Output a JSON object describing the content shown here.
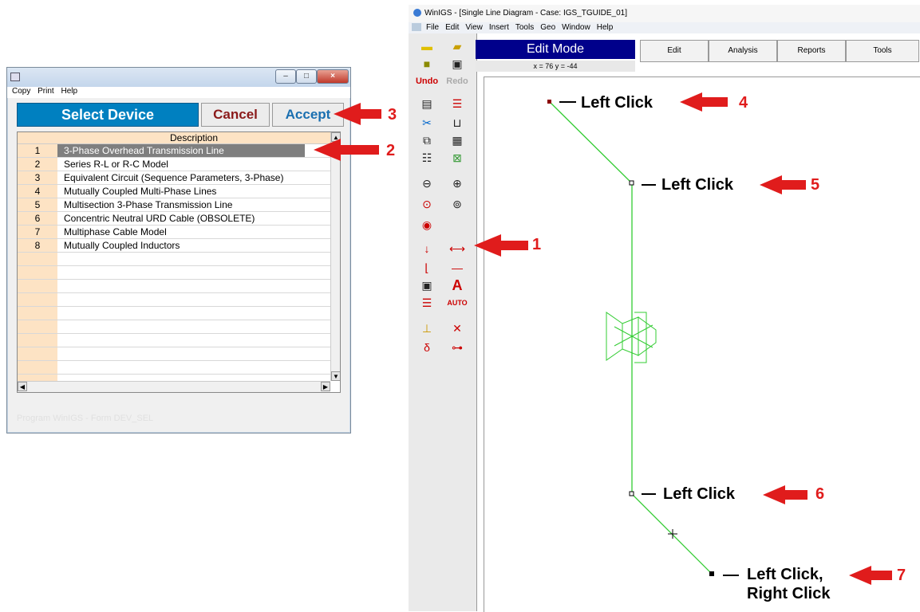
{
  "dialog": {
    "menu": [
      "Copy",
      "Print",
      "Help"
    ],
    "title_button": "Select Device",
    "cancel": "Cancel",
    "accept": "Accept",
    "column_header": "Description",
    "rows": [
      {
        "num": "1",
        "desc": "3-Phase Overhead Transmission Line"
      },
      {
        "num": "2",
        "desc": "Series R-L or R-C Model"
      },
      {
        "num": "3",
        "desc": "Equivalent Circuit (Sequence Parameters, 3-Phase)"
      },
      {
        "num": "4",
        "desc": "Mutually Coupled Multi-Phase Lines"
      },
      {
        "num": "5",
        "desc": "Multisection 3-Phase Transmission Line"
      },
      {
        "num": "6",
        "desc": "Concentric Neutral URD Cable (OBSOLETE)"
      },
      {
        "num": "7",
        "desc": "Multiphase Cable Model"
      },
      {
        "num": "8",
        "desc": "Mutually Coupled Inductors"
      }
    ],
    "status": "Program WinIGS - Form DEV_SEL"
  },
  "main": {
    "title": "WinIGS - [Single Line Diagram - Case: IGS_TGUIDE_01]",
    "menu": [
      "File",
      "Edit",
      "View",
      "Insert",
      "Tools",
      "Geo",
      "Window",
      "Help"
    ],
    "mode": "Edit Mode",
    "coords": "x = 76   y = -44",
    "tabs": [
      "Edit",
      "Analysis",
      "Reports",
      "Tools"
    ]
  },
  "callouts": {
    "c4": "Left Click",
    "c5": "Left Click",
    "c6": "Left Click",
    "c7a": "Left Click,",
    "c7b": "Right Click"
  },
  "numbers": {
    "n1": "1",
    "n2": "2",
    "n3": "3",
    "n4": "4",
    "n5": "5",
    "n6": "6",
    "n7": "7"
  },
  "colors": {
    "arrow": "#e01c1c",
    "line": "#33cc33",
    "mode_bg": "#00008b",
    "select_bg": "#0080c0"
  }
}
